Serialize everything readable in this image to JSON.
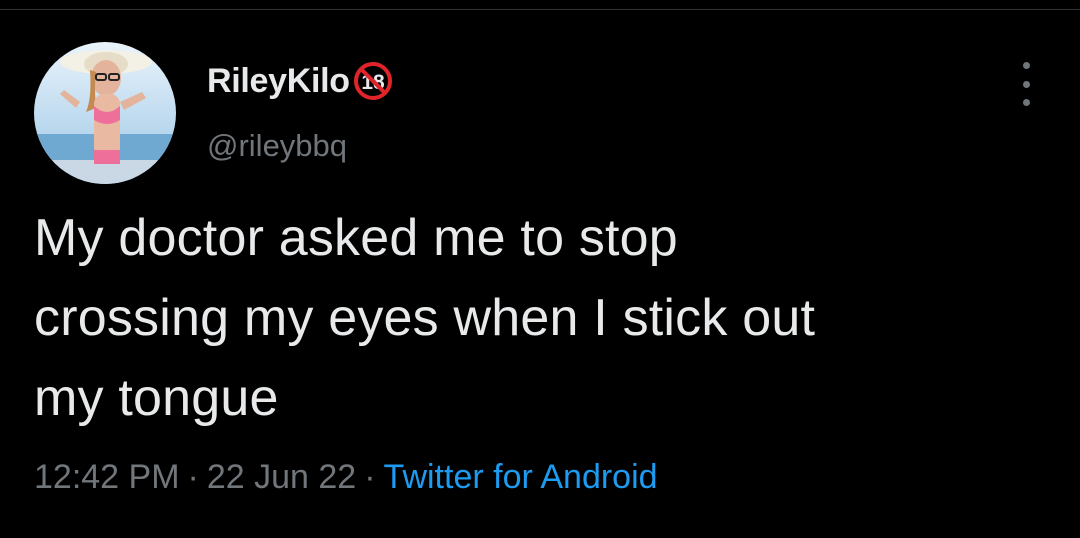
{
  "tweet": {
    "display_name": "RileyKilo",
    "badge_text": "18",
    "handle": "@rileybbq",
    "text_lines": [
      "My doctor asked me to stop",
      "crossing my eyes when I stick out",
      "my tongue"
    ],
    "time": "12:42 PM",
    "separator": "·",
    "date": "22 Jun 22",
    "source": "Twitter for Android"
  },
  "icons": {
    "avatar": "profile-photo",
    "badge": "no-under-18-icon",
    "more": "more-options-icon"
  },
  "colors": {
    "background": "#000000",
    "primary_text": "#e7e9ea",
    "secondary_text": "#71767b",
    "link": "#1d9bf0",
    "badge_red": "#e0242a"
  }
}
